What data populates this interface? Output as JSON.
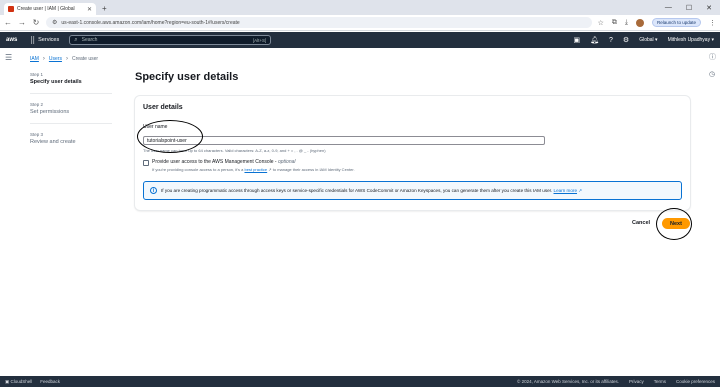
{
  "browser": {
    "tab_title": "Create user | IAM | Global",
    "url": "us-east-1.console.aws.amazon.com/iam/home?region=eu-south-1#/users/create",
    "relaunch_label": "Relaunch to update"
  },
  "aws_nav": {
    "logo": "aws",
    "services_label": "Services",
    "search_placeholder": "Search",
    "search_shortcut": "[Alt+S]",
    "region": "Global",
    "account": "Mithlesh Upadhyay"
  },
  "breadcrumb": {
    "iam": "IAM",
    "users": "Users",
    "current": "Create user"
  },
  "steps": [
    {
      "num": "Step 1",
      "title": "Specify user details"
    },
    {
      "num": "Step 2",
      "title": "Set permissions"
    },
    {
      "num": "Step 3",
      "title": "Review and create"
    }
  ],
  "page_title": "Specify user details",
  "panel": {
    "title": "User details",
    "user_name_label": "User name",
    "user_name_value": "tutorialspoint-user",
    "hint": "The user name can have up to 64 characters. Valid characters: A-Z, a-z, 0-9, and + = , . @ _ - (hyphen)",
    "checkbox_label": "Provide user access to the AWS Management Console - ",
    "checkbox_optional": "optional",
    "checkbox_desc_before": "If you're providing console access to a person, it's a ",
    "checkbox_desc_link": "best practice",
    "checkbox_desc_after": " to manage their access in IAM Identity Center.",
    "info_text": "If you are creating programmatic access through access keys or service-specific credentials for AWS CodeCommit or Amazon Keyspaces, you can generate them after you create this IAM user. ",
    "info_link": "Learn more"
  },
  "actions": {
    "cancel": "Cancel",
    "next": "Next"
  },
  "footer": {
    "cloudshell": "CloudShell",
    "feedback": "Feedback",
    "copyright": "© 2024, Amazon Web Services, Inc. or its affiliates.",
    "privacy": "Privacy",
    "terms": "Terms",
    "cookie": "Cookie preferences"
  },
  "colors": {
    "nav_bg": "#232f3e",
    "accent_orange": "#ff9900",
    "link_blue": "#0972d3"
  }
}
